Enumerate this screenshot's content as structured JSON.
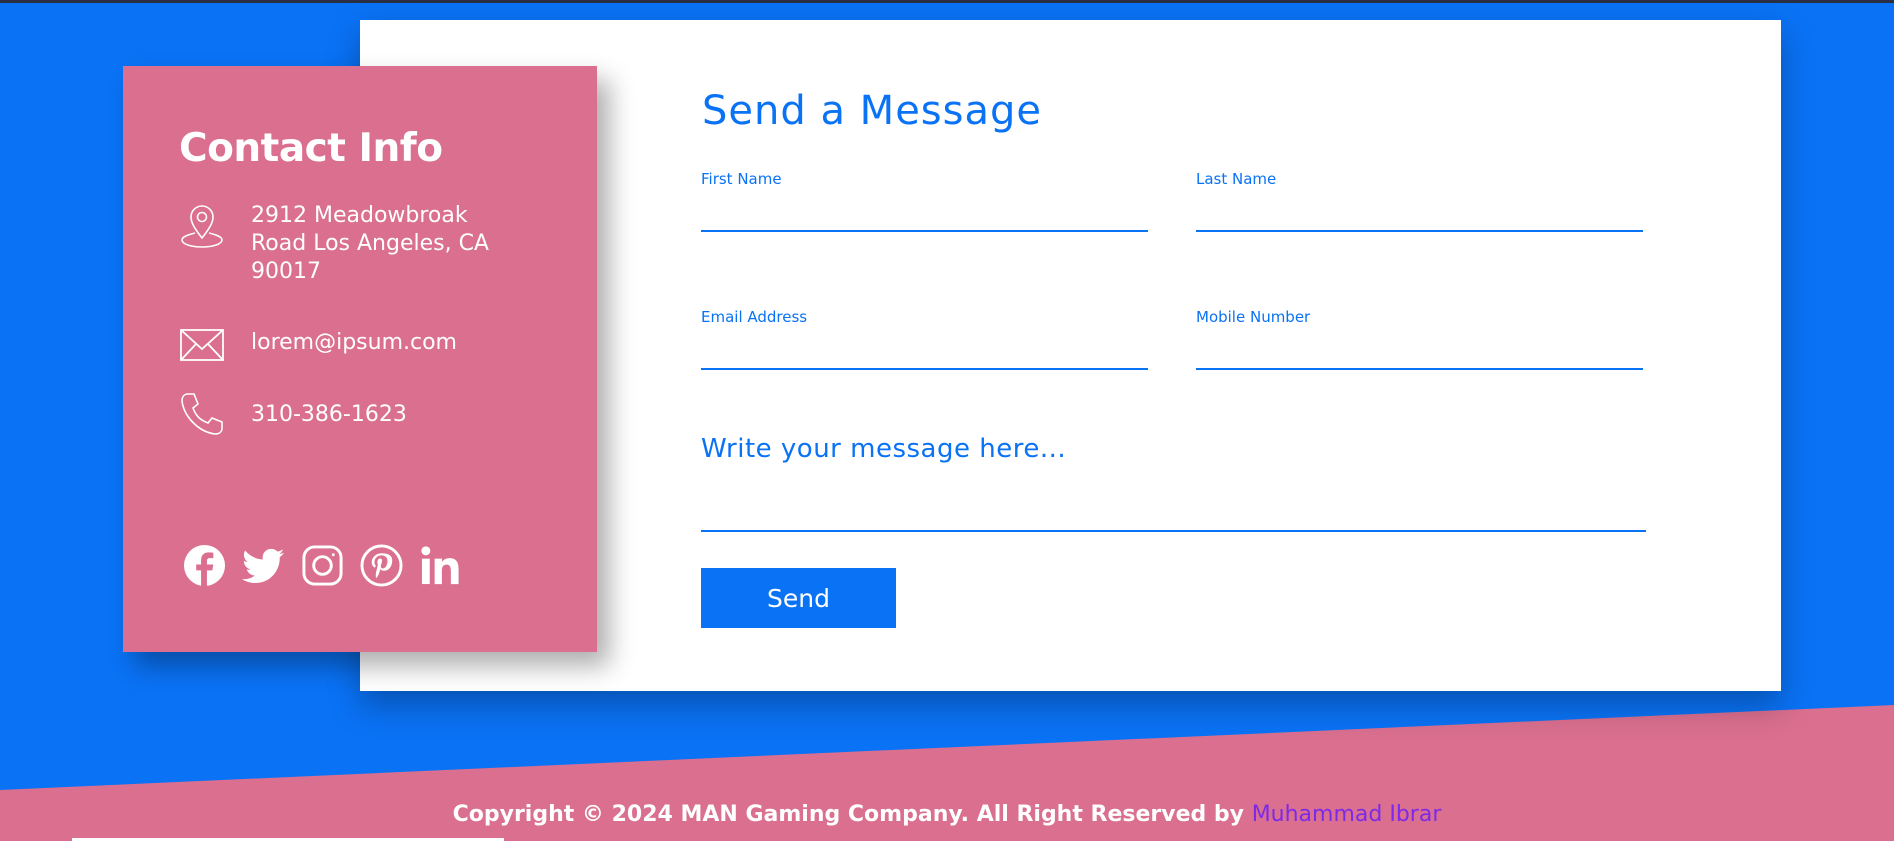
{
  "contact": {
    "title": "Contact Info",
    "address": "2912 Meadowbroak Road Los Angeles, CA 90017",
    "email": "lorem@ipsum.com",
    "phone": "310-386-1623",
    "socials": [
      {
        "icon": "facebook-icon"
      },
      {
        "icon": "twitter-icon"
      },
      {
        "icon": "instagram-icon"
      },
      {
        "icon": "pinterest-icon"
      },
      {
        "icon": "linkedin-icon"
      }
    ]
  },
  "form": {
    "title": "Send a Message",
    "first_name_label": "First Name",
    "last_name_label": "Last Name",
    "email_label": "Email Address",
    "mobile_label": "Mobile Number",
    "message_placeholder": "Write your message here...",
    "send_label": "Send",
    "first_name_value": "",
    "last_name_value": "",
    "email_value": "",
    "mobile_value": ""
  },
  "footer": {
    "copyright": "Copyright © 2024 MAN Gaming Company. All Right Reserved by",
    "author": "Muhammad Ibrar"
  },
  "colors": {
    "background": "#0a72f5",
    "card_pink": "#da6f8f",
    "accent_blue": "#0a72f5",
    "author_link": "#7d2ae8"
  }
}
